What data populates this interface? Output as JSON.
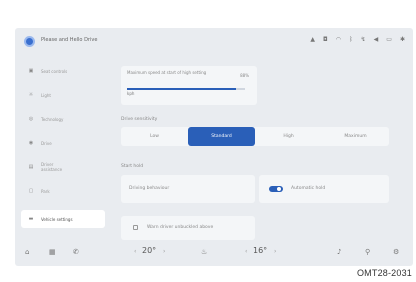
{
  "status_bar": {
    "app_title": "Please and Hello Drive",
    "icons": [
      "bell-icon",
      "camera-icon",
      "wifi-icon",
      "bluetooth-icon",
      "signal-icon",
      "volume-icon",
      "battery-icon",
      "settings-icon"
    ]
  },
  "sidebar": {
    "items": [
      {
        "label": "Seat controls",
        "icon": "seat-icon"
      },
      {
        "label": "Light",
        "icon": "light-icon"
      },
      {
        "label": "Technology",
        "icon": "technology-icon"
      },
      {
        "label": "Drive",
        "icon": "drive-icon"
      },
      {
        "label": "Driver\nassistance",
        "icon": "assistance-icon"
      },
      {
        "label": "Park",
        "icon": "park-icon"
      },
      {
        "label": "Vehicle settings",
        "icon": "vehicle-icon"
      }
    ]
  },
  "speed": {
    "title": "Maximum speed at start of high setting",
    "value": "kph",
    "percent": "88%",
    "fill_fraction": 0.92
  },
  "modes": {
    "section": "Drive sensitivity",
    "options": [
      "Low",
      "Standard",
      "High",
      "Maximum"
    ],
    "active_index": 1
  },
  "options_section": {
    "label": "Start hold",
    "left_label": "Driving behaviour",
    "right_label": "Automatic hold",
    "checkbox_label": "Warn driver unbuckled above"
  },
  "bottom_bar": {
    "left_temp": "20°",
    "right_temp": "16°"
  },
  "caption": "OMT28-2031",
  "colors": {
    "accent": "#2a5fb8",
    "screen_bg": "#e9ecf0"
  }
}
